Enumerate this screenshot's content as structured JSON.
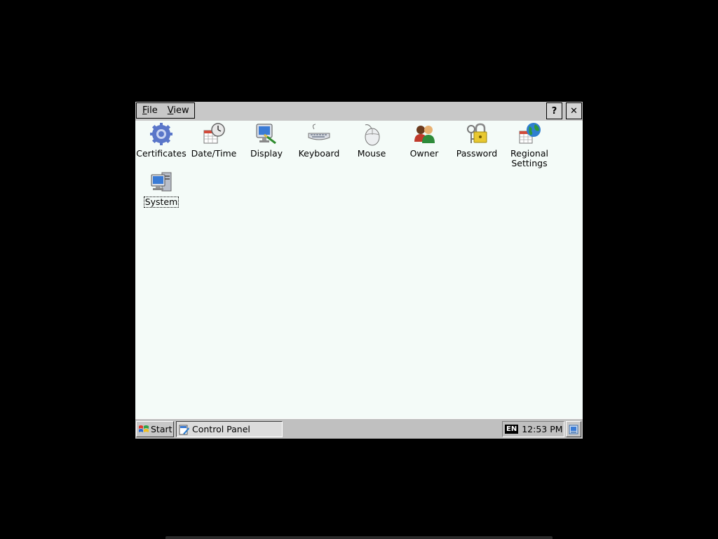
{
  "menu": {
    "file": {
      "accel": "F",
      "rest": "ile"
    },
    "view": {
      "accel": "V",
      "rest": "iew"
    }
  },
  "window_buttons": {
    "help": "?",
    "close": "✕"
  },
  "icons": [
    {
      "label": "Certificates",
      "icon": "certificates-icon"
    },
    {
      "label": "Date/Time",
      "icon": "date-time-icon"
    },
    {
      "label": "Display",
      "icon": "display-icon"
    },
    {
      "label": "Keyboard",
      "icon": "keyboard-icon"
    },
    {
      "label": "Mouse",
      "icon": "mouse-icon"
    },
    {
      "label": "Owner",
      "icon": "owner-icon"
    },
    {
      "label": "Password",
      "icon": "password-icon"
    },
    {
      "label": "Regional Settings",
      "icon": "regional-settings-icon"
    },
    {
      "label": "System",
      "icon": "system-icon",
      "selected": true
    }
  ],
  "taskbar": {
    "start_label": "Start",
    "task_label": "Control Panel",
    "input_lang": "EN",
    "clock": "12:53 PM"
  },
  "colors": {
    "content_bg": "#f4fbf8",
    "chrome": "#c0c0c0"
  }
}
